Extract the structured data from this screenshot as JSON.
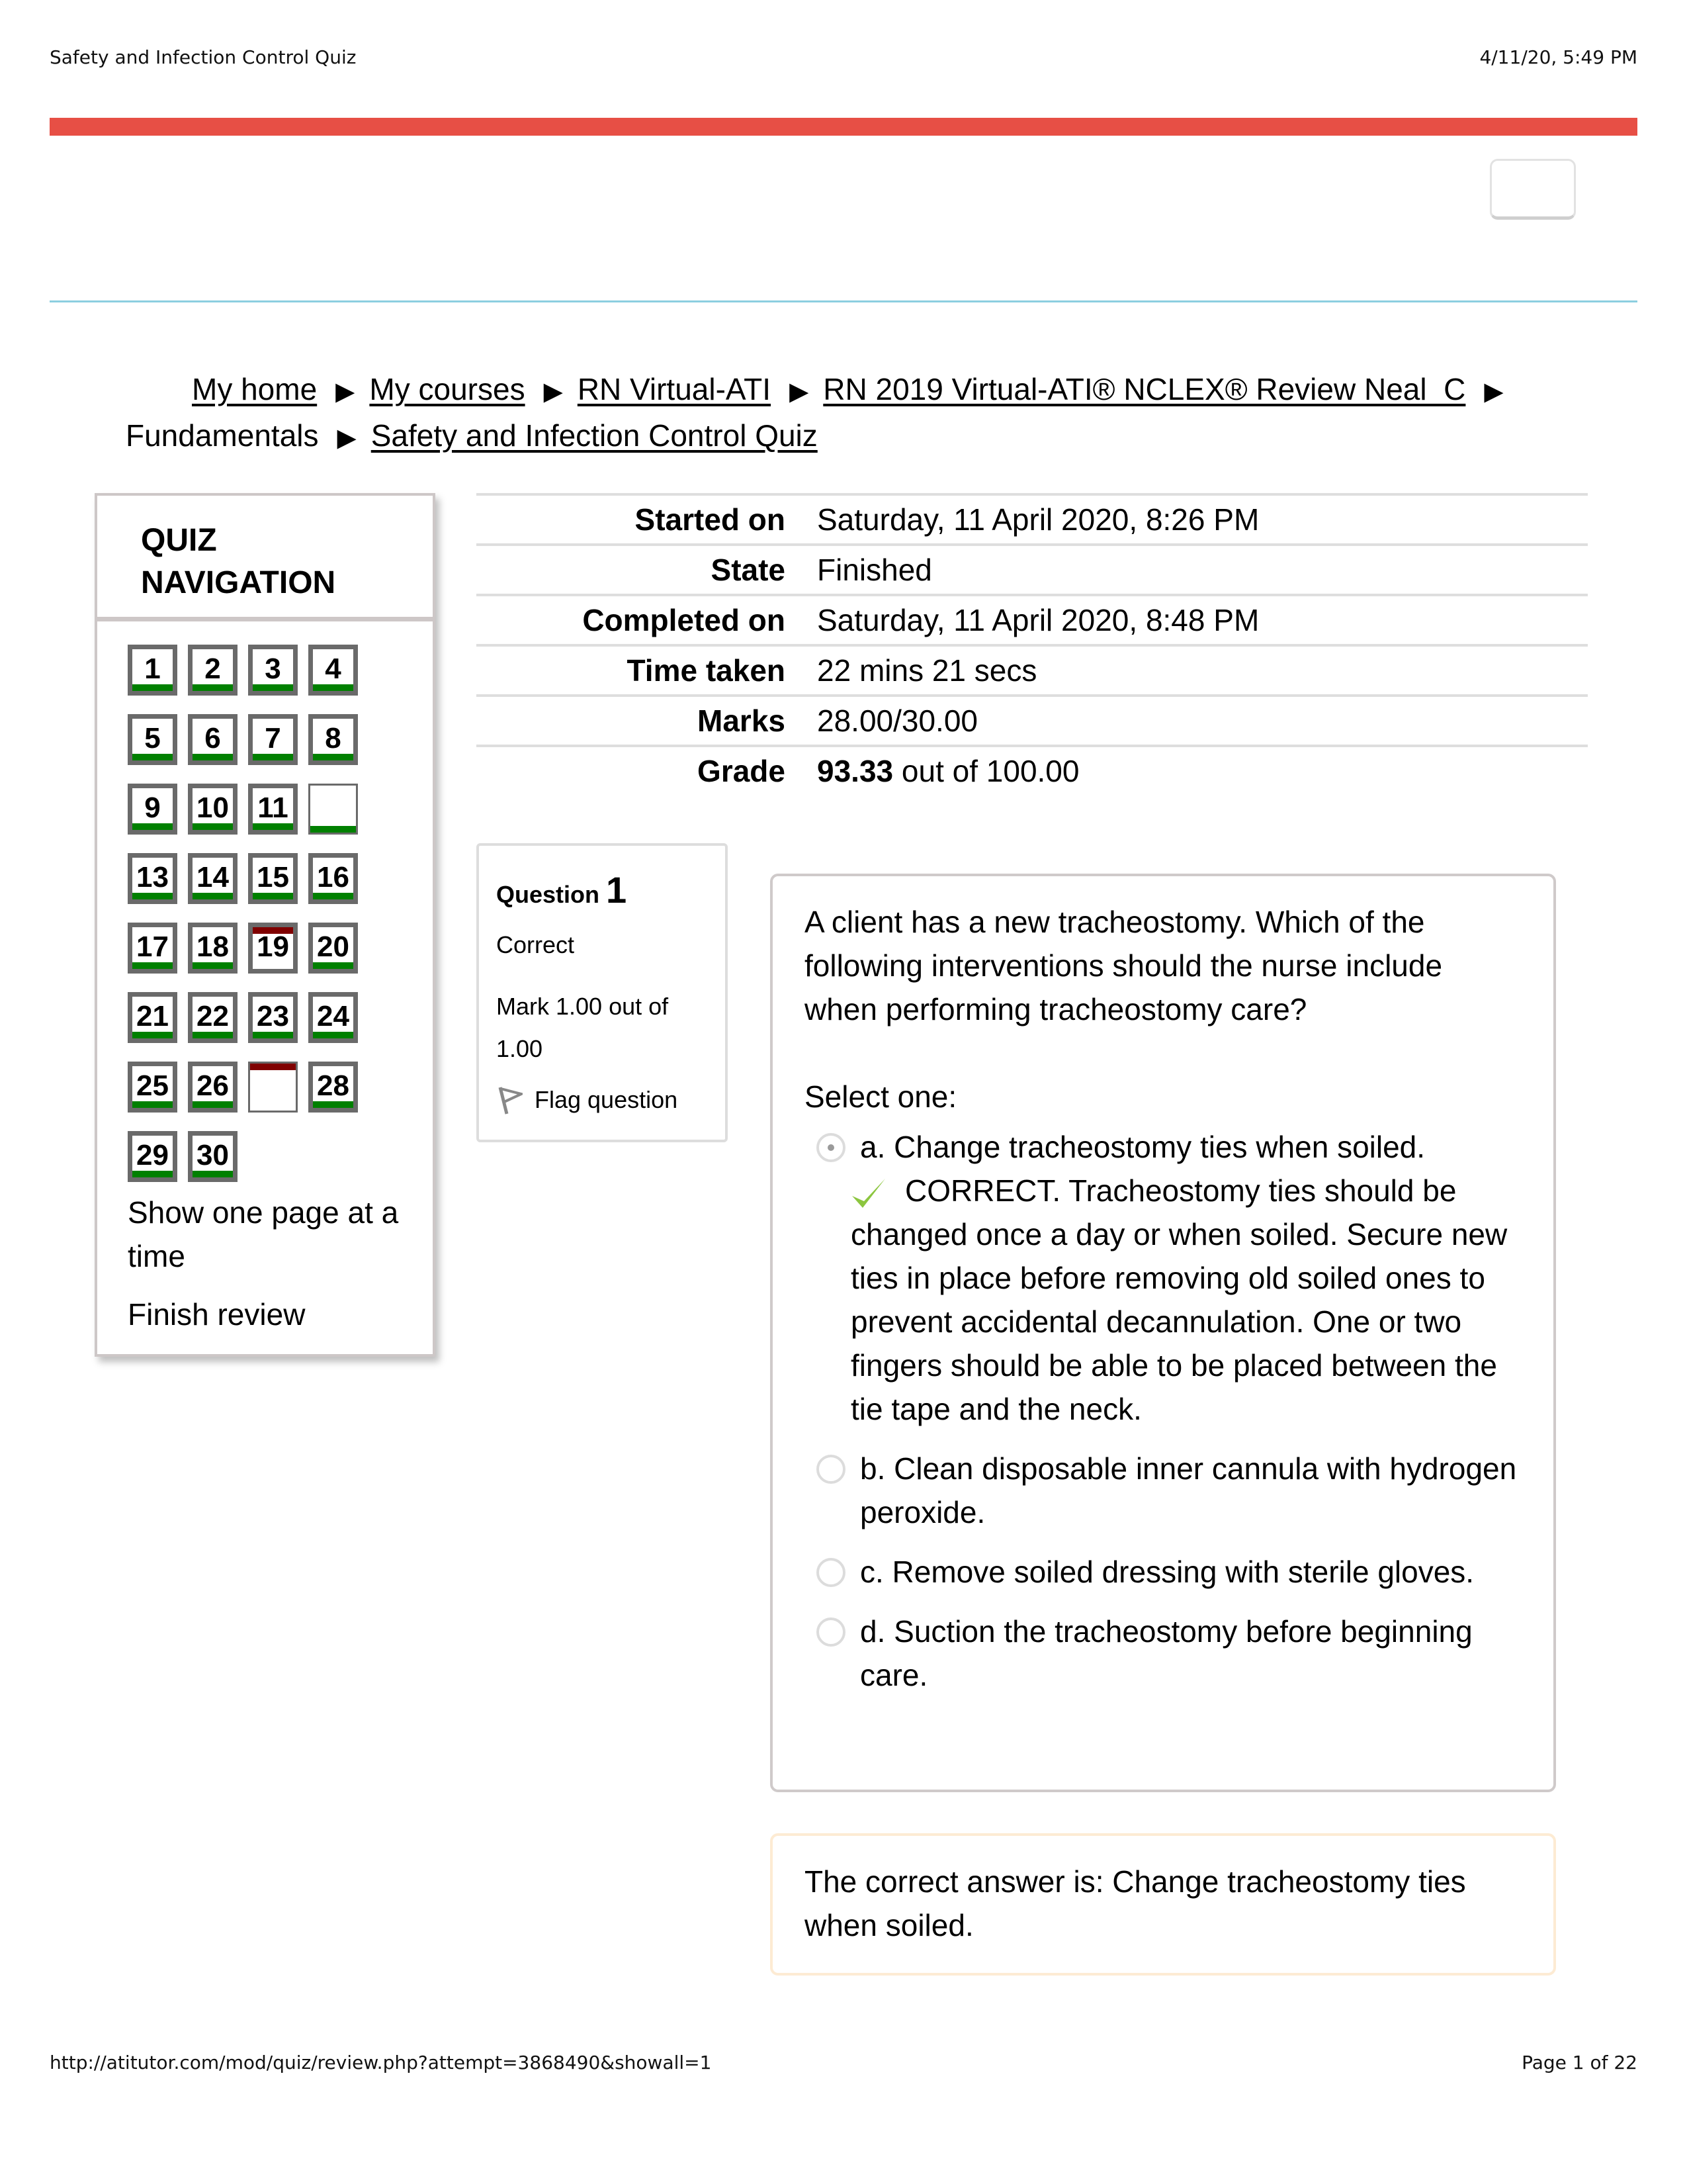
{
  "print_header": {
    "title": "Safety and Infection Control Quiz",
    "datetime": "4/11/20, 5:49 PM"
  },
  "print_footer": {
    "url": "http://atitutor.com/mod/quiz/review.php?attempt=3868490&showall=1",
    "page": "Page 1 of 22"
  },
  "colors": {
    "brand_bar": "#e74f45",
    "divider": "#8ccfe0",
    "correct": "#008000",
    "incorrect": "#800000",
    "check": "#8cc63f"
  },
  "breadcrumb": {
    "items": [
      {
        "label": "My home",
        "link": true
      },
      {
        "label": "My courses",
        "link": true
      },
      {
        "label": "RN Virtual-ATI",
        "link": true
      },
      {
        "label": "RN 2019 Virtual-ATI® NCLEX® Review Neal_C",
        "link": true
      },
      {
        "label": "Fundamentals",
        "link": false
      },
      {
        "label": "Safety and Infection Control Quiz",
        "link": true
      }
    ],
    "separator_icon": "triangle-right-icon"
  },
  "quiz_nav": {
    "title_line1": "QUIZ",
    "title_line2": "NAVIGATION",
    "buttons": [
      {
        "label": "1",
        "status": "correct"
      },
      {
        "label": "2",
        "status": "correct"
      },
      {
        "label": "3",
        "status": "correct"
      },
      {
        "label": "4",
        "status": "correct"
      },
      {
        "label": "5",
        "status": "correct"
      },
      {
        "label": "6",
        "status": "correct"
      },
      {
        "label": "7",
        "status": "correct"
      },
      {
        "label": "8",
        "status": "correct"
      },
      {
        "label": "9",
        "status": "correct"
      },
      {
        "label": "10",
        "status": "correct"
      },
      {
        "label": "11",
        "status": "correct"
      },
      {
        "label": "",
        "status": "correct"
      },
      {
        "label": "13",
        "status": "correct"
      },
      {
        "label": "14",
        "status": "correct"
      },
      {
        "label": "15",
        "status": "correct"
      },
      {
        "label": "16",
        "status": "correct"
      },
      {
        "label": "17",
        "status": "correct"
      },
      {
        "label": "18",
        "status": "correct"
      },
      {
        "label": "19",
        "status": "incorrect"
      },
      {
        "label": "20",
        "status": "correct"
      },
      {
        "label": "21",
        "status": "correct"
      },
      {
        "label": "22",
        "status": "correct"
      },
      {
        "label": "23",
        "status": "correct"
      },
      {
        "label": "24",
        "status": "correct"
      },
      {
        "label": "25",
        "status": "correct"
      },
      {
        "label": "26",
        "status": "correct"
      },
      {
        "label": "",
        "status": "incorrect"
      },
      {
        "label": "28",
        "status": "correct"
      },
      {
        "label": "29",
        "status": "correct"
      },
      {
        "label": "30",
        "status": "correct"
      }
    ],
    "show_one_page": "Show one page at a time",
    "finish_review": "Finish review"
  },
  "summary": {
    "rows": [
      {
        "label": "Started on",
        "value": "Saturday, 11 April 2020, 8:26 PM"
      },
      {
        "label": "State",
        "value": "Finished"
      },
      {
        "label": "Completed on",
        "value": "Saturday, 11 April 2020, 8:48 PM"
      },
      {
        "label": "Time taken",
        "value": "22 mins 21 secs"
      },
      {
        "label": "Marks",
        "value": "28.00/30.00"
      }
    ],
    "grade": {
      "label": "Grade",
      "score": "93.33",
      "rest": " out of 100.00"
    }
  },
  "question": {
    "label": "Question",
    "number": "1",
    "state": "Correct",
    "mark": "Mark 1.00 out of 1.00",
    "flag_label": "Flag question",
    "text": "A client has a new tracheostomy. Which of the following interventions should the nurse include when performing tracheostomy care?",
    "prompt": "Select one:",
    "options": [
      {
        "text": "a. Change tracheostomy ties when soiled.",
        "selected": true,
        "feedback": "CORRECT. Tracheostomy ties should be changed once a day or when soiled. Secure new ties in place before removing old soiled ones to prevent accidental decannulation. One or two fingers should be able to be placed between the tie tape and the neck."
      },
      {
        "text": "b. Clean disposable inner cannula with hydrogen peroxide.",
        "selected": false
      },
      {
        "text": "c. Remove soiled dressing with sterile gloves.",
        "selected": false
      },
      {
        "text": "d. Suction the tracheostomy before beginning care.",
        "selected": false
      }
    ],
    "correct_answer": "The correct answer is: Change tracheostomy ties when soiled."
  }
}
